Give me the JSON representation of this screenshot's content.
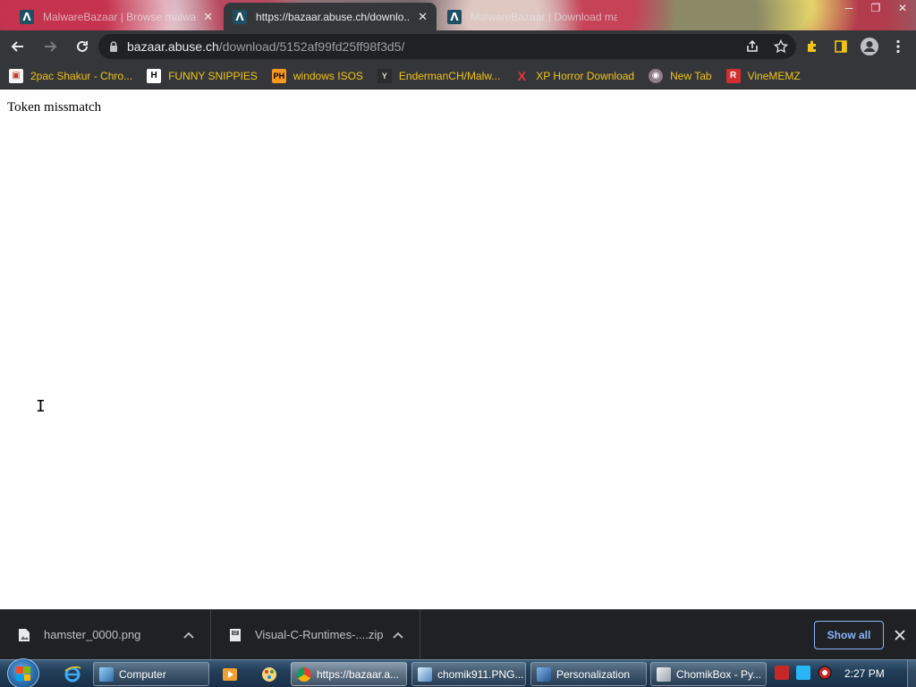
{
  "browser": {
    "tabs": [
      {
        "title": "MalwareBazaar | Browse malwa...",
        "active": false
      },
      {
        "title": "https://bazaar.abuse.ch/downlo...",
        "active": true
      },
      {
        "title": "MalwareBazaar | Download mal...",
        "active": false
      }
    ],
    "favicon_glyph": "Λ",
    "url_host": "bazaar.abuse.ch",
    "url_path": "/download/5152af99fd25ff98f3d5/"
  },
  "bookmarks": [
    {
      "label": "2pac Shakur - Chro...",
      "icon": "G",
      "icon_color": "#c0392b"
    },
    {
      "label": "FUNNY SNIPPIES",
      "icon": "H",
      "icon_color": "#ffffff"
    },
    {
      "label": "windows ISOS",
      "icon": "PH",
      "icon_color": "#f7971d"
    },
    {
      "label": "EndermanCH/Malw...",
      "icon": "Y",
      "icon_color": "#555555"
    },
    {
      "label": "XP Horror Download",
      "icon": "X",
      "icon_color": "#e53935"
    },
    {
      "label": "New Tab",
      "icon": "◉",
      "icon_color": "#bbbbbb"
    },
    {
      "label": "VineMEMZ",
      "icon": "R",
      "icon_color": "#d32f2f"
    }
  ],
  "page": {
    "message": "Token missmatch"
  },
  "downloads": {
    "items": [
      {
        "name": "hamster_0000.png"
      },
      {
        "name": "Visual-C-Runtimes-....zip"
      }
    ],
    "show_all_label": "Show all"
  },
  "taskbar": {
    "tasks": [
      {
        "label": "Computer",
        "active": false
      },
      {
        "label": "https://bazaar.a...",
        "active": true
      },
      {
        "label": "chomik911.PNG...",
        "active": false
      },
      {
        "label": "Personalization",
        "active": false
      },
      {
        "label": "ChomikBox - Py...",
        "active": false
      }
    ],
    "clock": "2:27 PM"
  },
  "colors": {
    "bookmark_text": "#f0c419",
    "accent_blue": "#8ab4f8",
    "chrome_dark": "#35363a"
  }
}
